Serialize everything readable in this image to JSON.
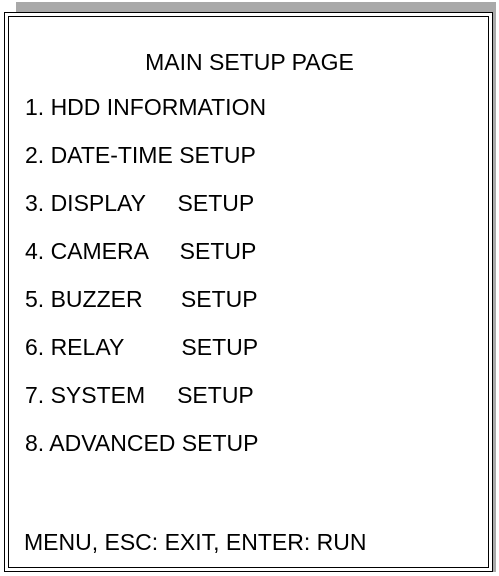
{
  "screen": {
    "title": "MAIN SETUP PAGE",
    "menu_items": [
      {
        "label": "1. HDD INFORMATION"
      },
      {
        "label": "2. DATE-TIME SETUP"
      },
      {
        "label": "3. DISPLAY     SETUP"
      },
      {
        "label": "4. CAMERA     SETUP"
      },
      {
        "label": "5. BUZZER      SETUP"
      },
      {
        "label": "6. RELAY         SETUP"
      },
      {
        "label": "7. SYSTEM     SETUP"
      },
      {
        "label": "8. ADVANCED SETUP"
      }
    ],
    "footer_hint": "MENU, ESC: EXIT, ENTER: RUN"
  },
  "colors": {
    "shadow": "#a9a9a9",
    "border": "#000000",
    "background": "#ffffff",
    "text": "#000000"
  }
}
